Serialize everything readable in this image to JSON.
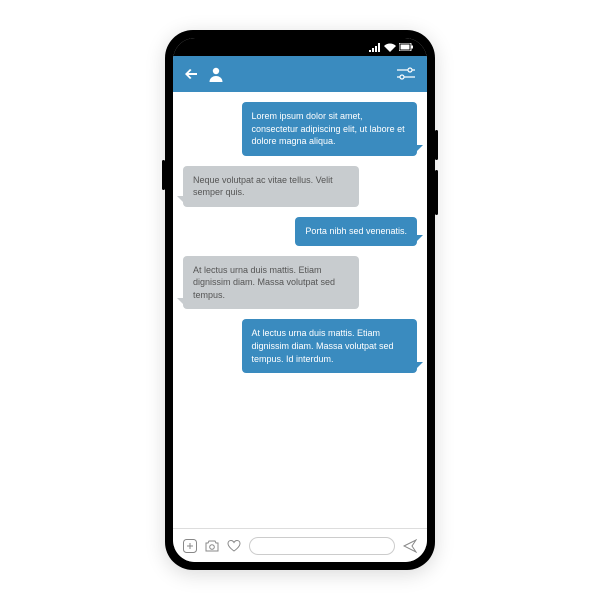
{
  "header": {
    "accent_color": "#3a8bbf"
  },
  "messages": [
    {
      "type": "sent",
      "text": "Lorem ipsum dolor sit amet, consectetur adipiscing elit, ut labore et dolore magna aliqua."
    },
    {
      "type": "received",
      "text": "Neque volutpat ac vitae tellus. Velit semper quis."
    },
    {
      "type": "sent",
      "text": "Porta nibh sed venenatis."
    },
    {
      "type": "received",
      "text": "At lectus urna duis mattis. Etiam dignissim diam. Massa volutpat sed tempus."
    },
    {
      "type": "sent",
      "text": "At lectus urna duis mattis. Etiam dignissim diam. Massa volutpat sed tempus. Id interdum."
    }
  ],
  "input": {
    "placeholder": ""
  }
}
